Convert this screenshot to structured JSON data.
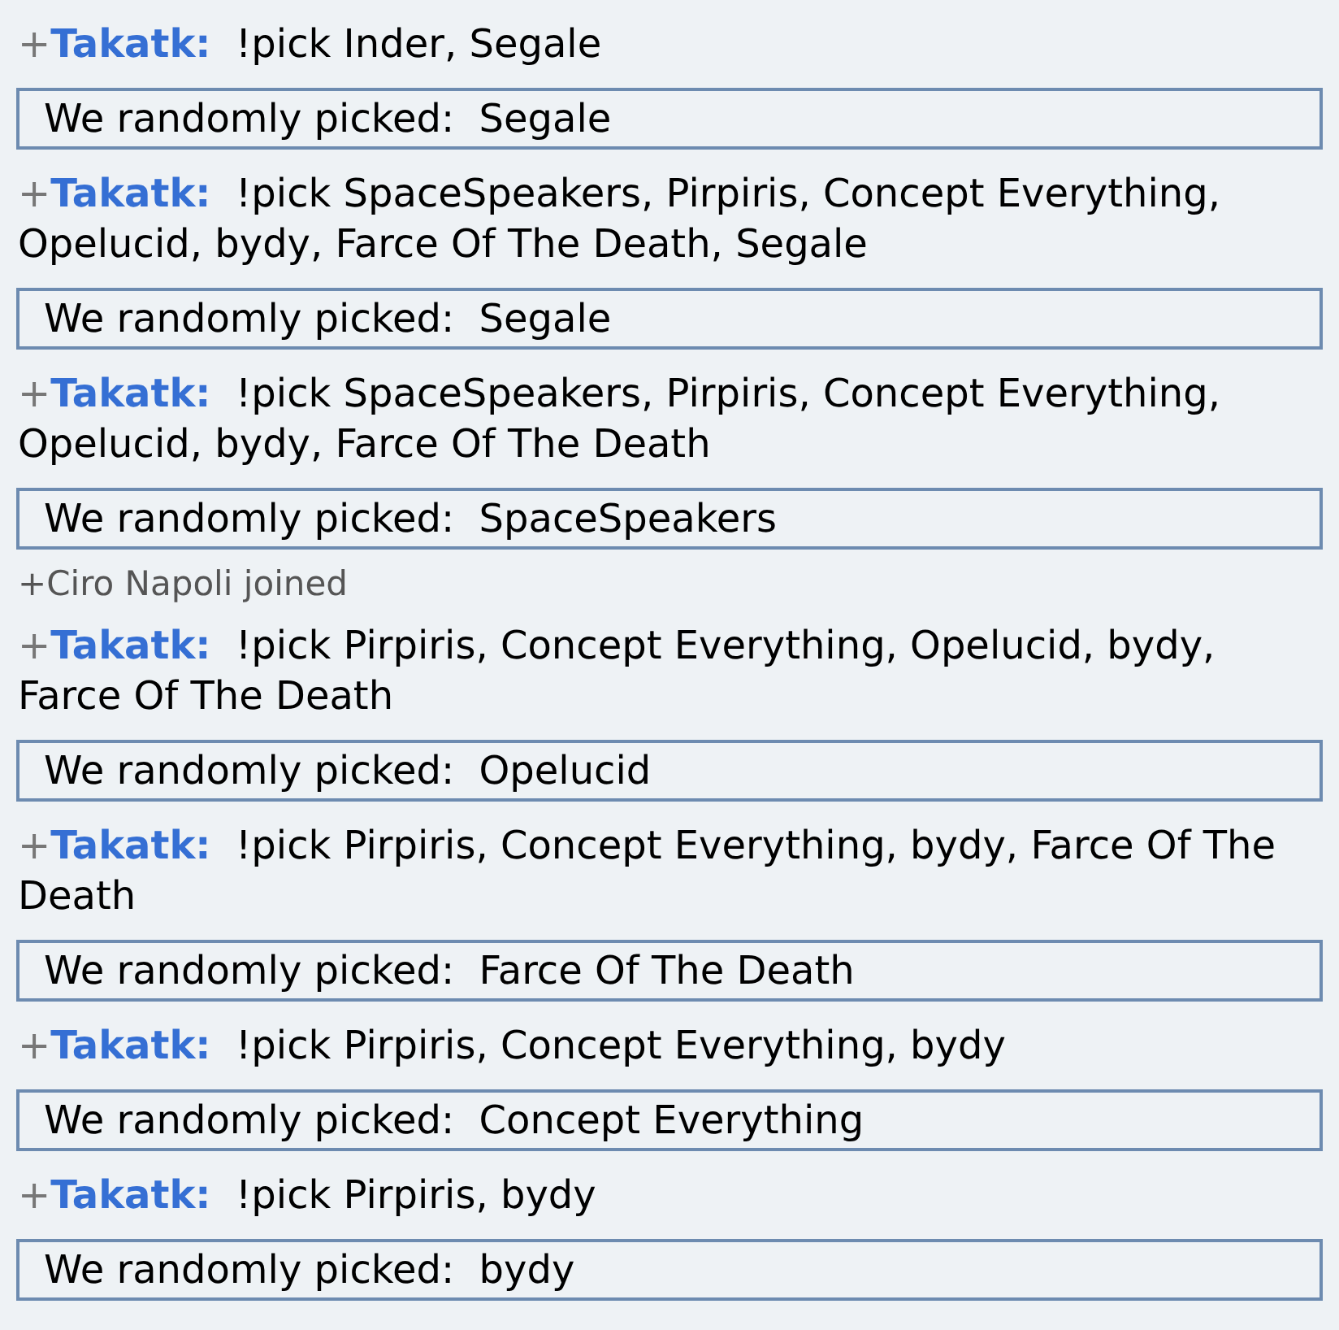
{
  "messages": [
    {
      "kind": "chat",
      "rank": "+",
      "user": "Takatk:",
      "text": "!pick Inder, Segale"
    },
    {
      "kind": "box",
      "text": "We randomly picked:  Segale"
    },
    {
      "kind": "chat",
      "rank": "+",
      "user": "Takatk:",
      "text": "!pick SpaceSpeakers, Pirpiris, Concept Everything, Opelucid, bydy, Farce Of The Death, Segale"
    },
    {
      "kind": "box",
      "text": "We randomly picked:  Segale"
    },
    {
      "kind": "chat",
      "rank": "+",
      "user": "Takatk:",
      "text": "!pick SpaceSpeakers, Pirpiris, Concept Everything, Opelucid, bydy, Farce Of The Death"
    },
    {
      "kind": "box",
      "text": "We randomly picked:  SpaceSpeakers"
    },
    {
      "kind": "join",
      "text": "+Ciro Napoli joined"
    },
    {
      "kind": "chat",
      "rank": "+",
      "user": "Takatk:",
      "text": "!pick Pirpiris, Concept Everything, Opelucid, bydy, Farce Of The Death"
    },
    {
      "kind": "box",
      "text": "We randomly picked:  Opelucid"
    },
    {
      "kind": "chat",
      "rank": "+",
      "user": "Takatk:",
      "text": "!pick Pirpiris, Concept Everything, bydy, Farce Of The Death"
    },
    {
      "kind": "box",
      "text": "We randomly picked:  Farce Of The Death"
    },
    {
      "kind": "chat",
      "rank": "+",
      "user": "Takatk:",
      "text": "!pick Pirpiris, Concept Everything, bydy"
    },
    {
      "kind": "box",
      "text": "We randomly picked:  Concept Everything"
    },
    {
      "kind": "chat",
      "rank": "+",
      "user": "Takatk:",
      "text": "!pick Pirpiris, bydy"
    },
    {
      "kind": "box",
      "text": "We randomly picked:  bydy"
    }
  ]
}
